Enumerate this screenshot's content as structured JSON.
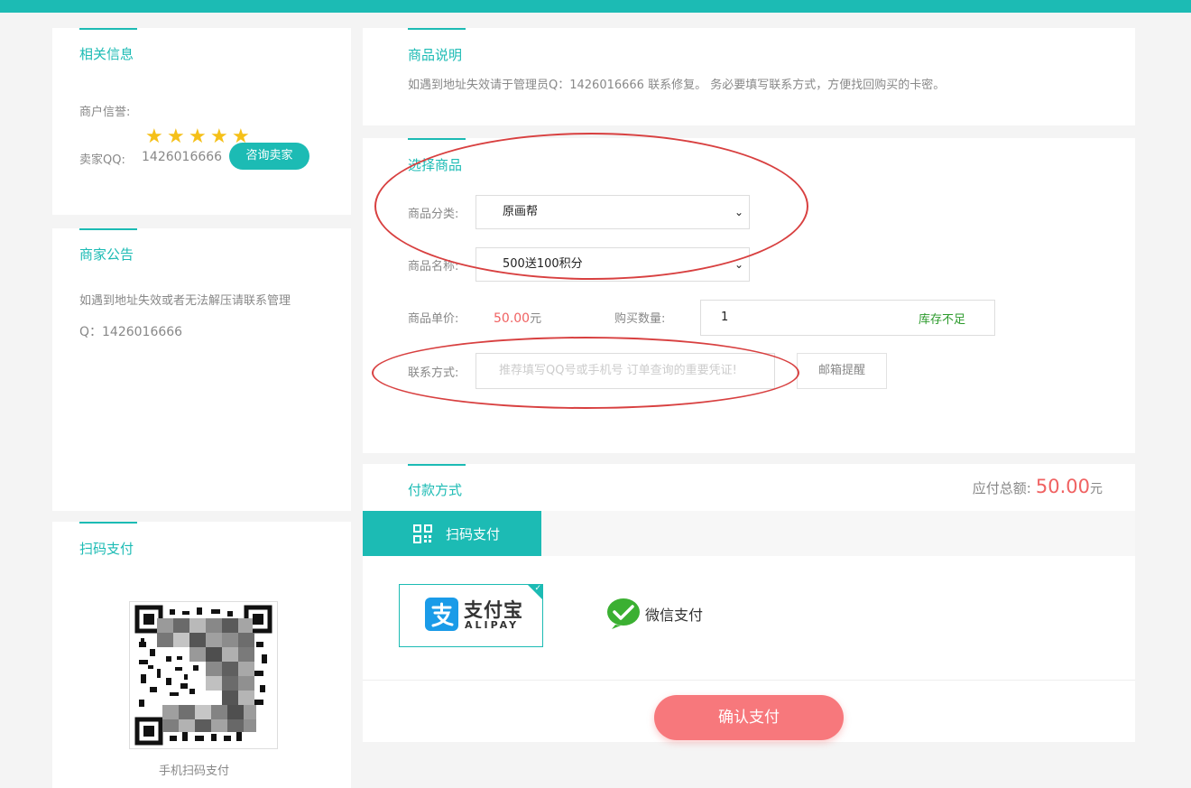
{
  "colors": {
    "accent": "#1cbbb4",
    "price": "#f06262",
    "stock": "#2b9a2b",
    "confirm": "#f7787c",
    "annotation": "#d84040"
  },
  "info": {
    "title": "相关信息",
    "rating_label": "商户信誉:",
    "rating_stars": 5,
    "qq_label": "卖家QQ:",
    "qq_value": "1426016666",
    "consult_button": "咨询卖家"
  },
  "notice": {
    "title": "商家公告",
    "line1": "如遇到地址失效或者无法解压请联系管理",
    "line2": "Q：1426016666"
  },
  "scan": {
    "title": "扫码支付",
    "caption": "手机扫码支付"
  },
  "description": {
    "title": "商品说明",
    "text": "如遇到地址失效请于管理员Q：1426016666 联系修复。 务必要填写联系方式，方便找回购买的卡密。"
  },
  "select": {
    "title": "选择商品",
    "category_label": "商品分类:",
    "category_value": "原画帮",
    "name_label": "商品名称:",
    "name_value": "500送100积分",
    "price_label": "商品单价:",
    "price_value": "50.00",
    "price_unit": "元",
    "qty_label": "购买数量:",
    "qty_value": "1",
    "stock_text": "库存不足",
    "contact_label": "联系方式:",
    "contact_placeholder": "推荐填写QQ号或手机号 订单查询的重要凭证!",
    "email_button": "邮箱提醒"
  },
  "payment": {
    "title": "付款方式",
    "total_label": "应付总额:",
    "total_value": "50.00",
    "total_unit": "元",
    "tab_label": "扫码支付",
    "alipay_cn": "支付宝",
    "alipay_en": "ALIPAY",
    "wechat_label": "微信支付",
    "confirm_button": "确认支付"
  }
}
